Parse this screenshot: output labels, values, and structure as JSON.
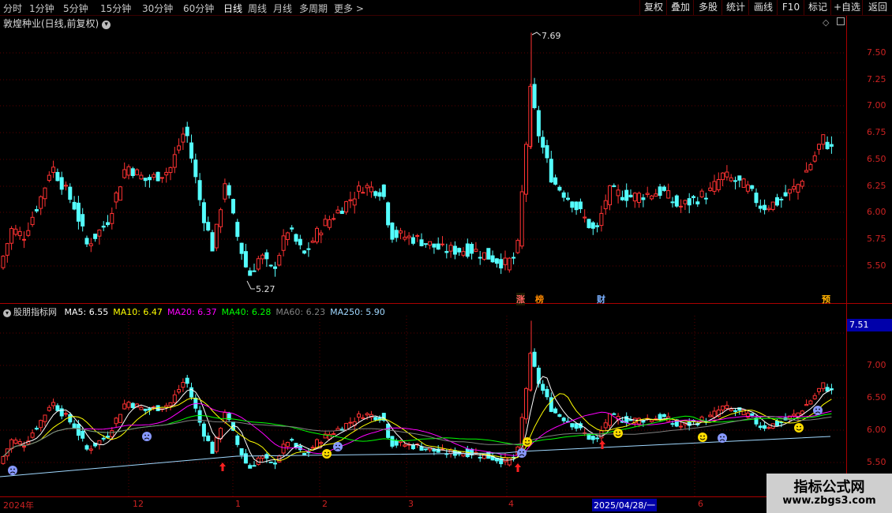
{
  "toolbar": {
    "periods": [
      "分时",
      "1分钟",
      "5分钟",
      "15分钟",
      "30分钟",
      "60分钟",
      "日线",
      "周线",
      "月线",
      "多周期",
      "更多 >"
    ],
    "active_period": "日线",
    "buttons": [
      "复权",
      "叠加",
      "多股",
      "统计",
      "画线",
      "F10",
      "标记",
      "+自选",
      "返回"
    ]
  },
  "main_chart": {
    "title": "敦煌种业(日线,前复权)",
    "high_label": "7.69",
    "low_label": "5.27",
    "y_ticks": [
      "7.50",
      "7.25",
      "7.00",
      "6.75",
      "6.50",
      "6.25",
      "6.00",
      "5.75",
      "5.50"
    ],
    "badges": [
      "涨",
      "榜",
      "财",
      "预"
    ]
  },
  "indicator": {
    "name": "股朋指标网",
    "ma": [
      {
        "label": "MA5:",
        "value": "6.55",
        "color": "#ffffff"
      },
      {
        "label": "MA10:",
        "value": "6.47",
        "color": "#ffff00"
      },
      {
        "label": "MA20:",
        "value": "6.37",
        "color": "#ff00ff"
      },
      {
        "label": "MA40:",
        "value": "6.28",
        "color": "#00ff00"
      },
      {
        "label": "MA60:",
        "value": "6.23",
        "color": "#808080"
      },
      {
        "label": "MA250:",
        "value": "5.90",
        "color": "#a0d8ff"
      }
    ],
    "current_price": "7.51",
    "y_ticks": [
      "7.50",
      "7.00",
      "6.50",
      "6.00",
      "5.50"
    ]
  },
  "date_axis": {
    "labels": [
      "2024年",
      "12",
      "1",
      "2",
      "3",
      "4",
      "2025/04/28/一",
      "6"
    ],
    "selected": "2025/04/28/一"
  },
  "watermark": {
    "title": "指标公式网",
    "url": "www.zbgs3.com"
  },
  "colors": {
    "up": "#ff3232",
    "down": "#54ffff",
    "grid": "#5a0000",
    "axis": "#cc2222"
  }
}
